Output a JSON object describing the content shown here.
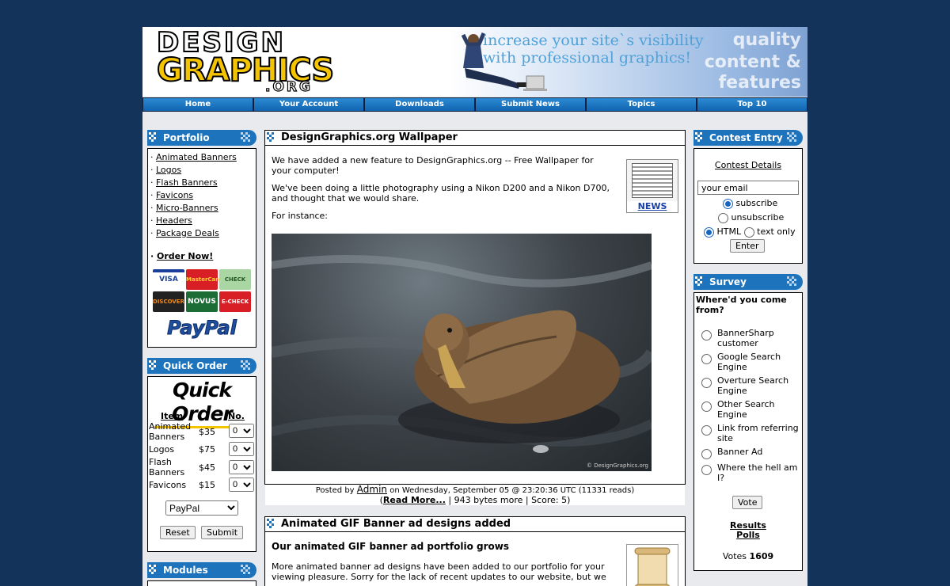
{
  "logo": {
    "line1": "DESIGN",
    "line2": "GRAPHICS",
    "line3": ".ORG"
  },
  "banner": {
    "tagline1": "increase your site`s visibility",
    "tagline2": "with professional graphics!",
    "side1": "quality",
    "side2": "content &",
    "side3": "features"
  },
  "nav": [
    "Home",
    "Your Account",
    "Downloads",
    "Submit News",
    "Topics",
    "Top 10"
  ],
  "portfolio": {
    "title": "Portfolio",
    "links": [
      "Animated Banners",
      "Logos",
      "Flash Banners",
      "Favicons",
      "Micro-Banners",
      "Headers",
      "Package Deals"
    ],
    "order_now": "Order Now!",
    "cards": [
      "VISA",
      "MasterCard",
      "CHECK",
      "DISCOVER",
      "NOVUS",
      "E-CHECK"
    ],
    "paypal": "PayPal"
  },
  "quick_order": {
    "title": "Quick Order",
    "heading": "Quick Order",
    "col_item": "Item",
    "col_no": "No.",
    "rows": [
      {
        "item": "Animated Banners",
        "price": "$35",
        "qty": "0"
      },
      {
        "item": "Logos",
        "price": "$75",
        "qty": "0"
      },
      {
        "item": "Flash Banners",
        "price": "$45",
        "qty": "0"
      },
      {
        "item": "Favicons",
        "price": "$15",
        "qty": "0"
      }
    ],
    "payment": "PayPal",
    "reset": "Reset",
    "submit": "Submit"
  },
  "modules": {
    "title": "Modules"
  },
  "article1": {
    "title": "DesignGraphics.org Wallpaper",
    "p1": "We have added a new feature to DesignGraphics.org -- Free Wallpaper for your computer!",
    "p2": "We've been doing a little photography using a Nikon D200 and a Nikon D700, and thought that we would share.",
    "p3": "For instance:",
    "topic_label": "NEWS",
    "photo_credit": "© DesignGraphics.org",
    "posted_by": "Posted by",
    "author": "Admin",
    "posted_on": "on Wednesday, September 05 @ 23:20:36 UTC (11331 reads)",
    "read_more": "Read More...",
    "bytes": "943 bytes more",
    "score": "Score: 5"
  },
  "article2": {
    "title": "Animated GIF Banner ad designs added",
    "subtitle": "Our animated GIF banner ad portfolio grows",
    "p1": "More animated banner ad designs have been added to our portfolio for your viewing pleasure. Sorry for the lack of recent updates to our website, but we"
  },
  "contest": {
    "title": "Contest Entry",
    "details": "Contest Details",
    "email_value": "your email",
    "subscribe": "subscribe",
    "unsubscribe": "unsubscribe",
    "html": "HTML",
    "text_only": "text only",
    "enter": "Enter"
  },
  "survey": {
    "title": "Survey",
    "question": "Where'd you come from?",
    "options": [
      "BannerSharp customer",
      "Google Search Engine",
      "Overture Search Engine",
      "Other Search Engine",
      "Link from referring site",
      "Banner Ad",
      "Where the hell am I?"
    ],
    "vote": "Vote",
    "results": "Results",
    "polls": "Polls",
    "votes_label": "Votes",
    "votes_count": "1609"
  },
  "colors": {
    "background": "#13335b",
    "block_header": "#1d74bd",
    "logo_yellow": "#f5c400"
  }
}
